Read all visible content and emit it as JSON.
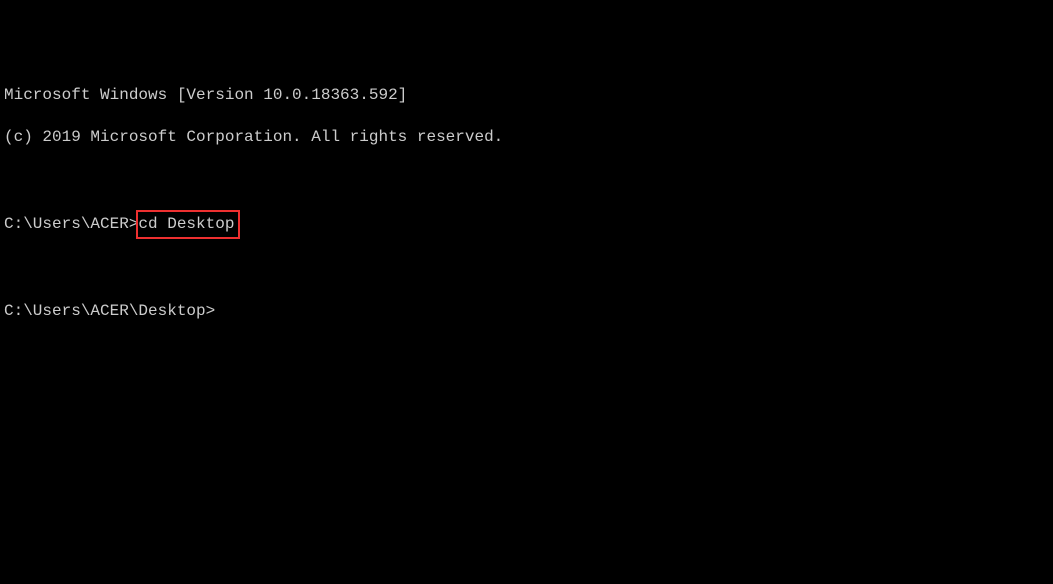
{
  "header": {
    "line1": "Microsoft Windows [Version 10.0.18363.592]",
    "line2": "(c) 2019 Microsoft Corporation. All rights reserved."
  },
  "prompts": {
    "first": {
      "path": "C:\\Users\\ACER>",
      "command": "cd Desktop"
    },
    "second": {
      "path": "C:\\Users\\ACER\\Desktop>"
    }
  }
}
